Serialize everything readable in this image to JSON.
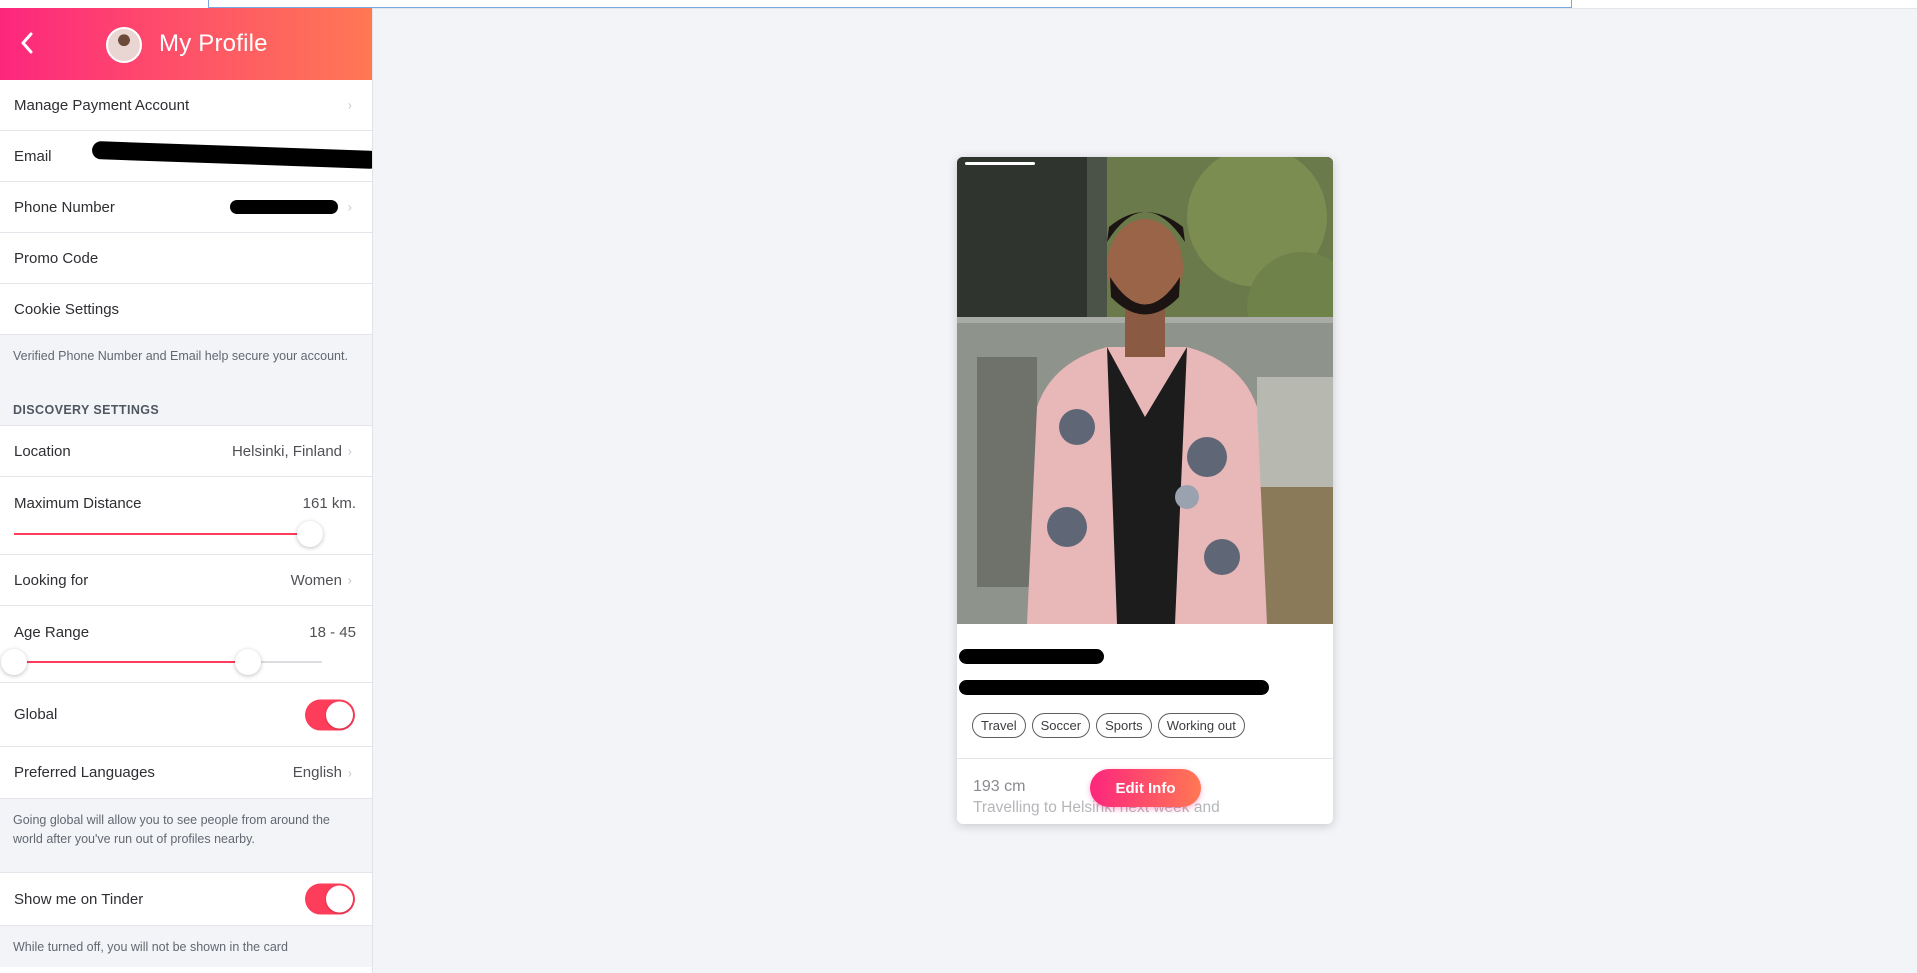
{
  "header": {
    "title": "My Profile",
    "back_icon": "chevron-left-icon"
  },
  "account": {
    "manage_payment": "Manage Payment Account",
    "email_label": "Email",
    "phone_label": "Phone Number",
    "promo_label": "Promo Code",
    "cookie_label": "Cookie Settings",
    "verify_note": "Verified Phone Number and Email help secure your account."
  },
  "discovery": {
    "section_title": "DISCOVERY SETTINGS",
    "location_label": "Location",
    "location_value": "Helsinki, Finland",
    "distance_label": "Maximum Distance",
    "distance_value": "161 km.",
    "distance_fraction": 0.96,
    "looking_label": "Looking for",
    "looking_value": "Women",
    "age_label": "Age Range",
    "age_value": "18 - 45",
    "age_min_fraction": 0.0,
    "age_max_fraction": 0.76,
    "global_label": "Global",
    "global_on": true,
    "languages_label": "Preferred Languages",
    "languages_value": "English",
    "global_note": "Going global will allow you to see people from around the world after you've run out of profiles nearby.",
    "show_label": "Show me on Tinder",
    "show_on": true,
    "show_note": "While turned off, you will not be shown in the card"
  },
  "card": {
    "tags": [
      "Travel",
      "Soccer",
      "Sports",
      "Working out"
    ],
    "height": "193 cm",
    "bio": "Travelling to Helsinki next week and",
    "edit_button": "Edit Info"
  },
  "colors": {
    "accent": "#fd3d5a",
    "gradient_start": "#fd267d",
    "gradient_end": "#ff7854",
    "background": "#f3f4f8"
  }
}
